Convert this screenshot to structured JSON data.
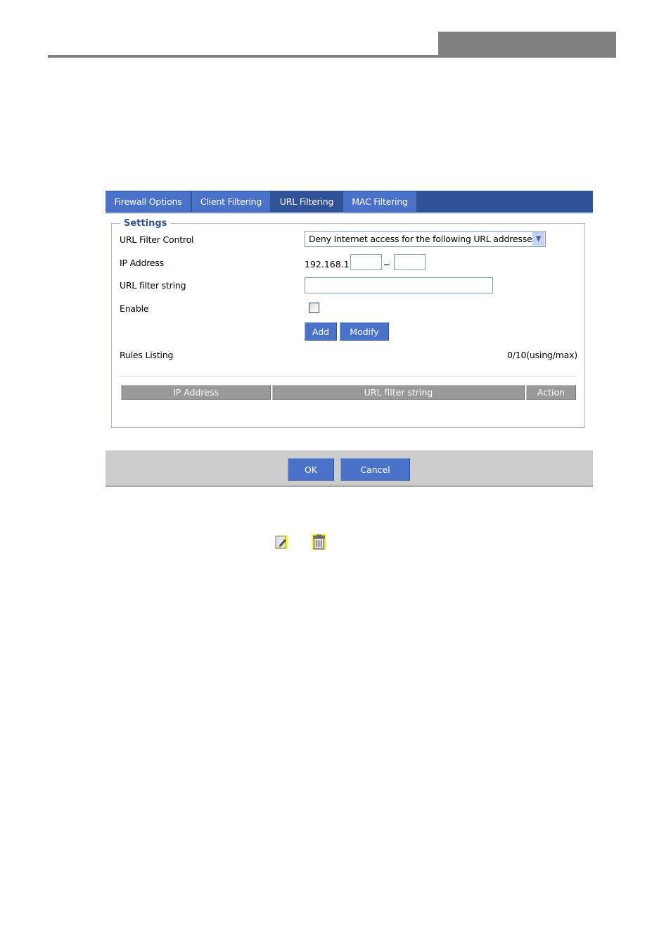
{
  "tabs": [
    {
      "label": "Firewall Options",
      "active": false
    },
    {
      "label": "Client Filtering",
      "active": false
    },
    {
      "label": "URL Filtering",
      "active": true
    },
    {
      "label": "MAC Filtering",
      "active": false
    }
  ],
  "settings": {
    "legend": "Settings",
    "url_filter_control": {
      "label": "URL Filter Control",
      "selected": "Deny Internet access for the following URL addresses"
    },
    "ip_address": {
      "label": "IP Address",
      "prefix": "192.168.1.",
      "start_value": "",
      "separator": "~",
      "end_value": ""
    },
    "url_filter_string": {
      "label": "URL filter string",
      "value": ""
    },
    "enable": {
      "label": "Enable",
      "checked": false
    },
    "buttons": {
      "add": "Add",
      "modify": "Modify"
    },
    "rules_listing": {
      "label": "Rules Listing",
      "count": "0/10(using/max)"
    },
    "table": {
      "columns": [
        "IP Address",
        "URL filter string",
        "Action"
      ],
      "rows": []
    }
  },
  "footer": {
    "ok": "OK",
    "cancel": "Cancel"
  },
  "legend_icons": [
    {
      "name": "edit-icon"
    },
    {
      "name": "delete-icon"
    }
  ],
  "colors": {
    "tab_bar": "#2f5396",
    "tab": "#4a72c8",
    "button": "#4a72c8",
    "table_header": "#999999",
    "footer_bar": "#cccccc",
    "header_block": "#808080"
  }
}
